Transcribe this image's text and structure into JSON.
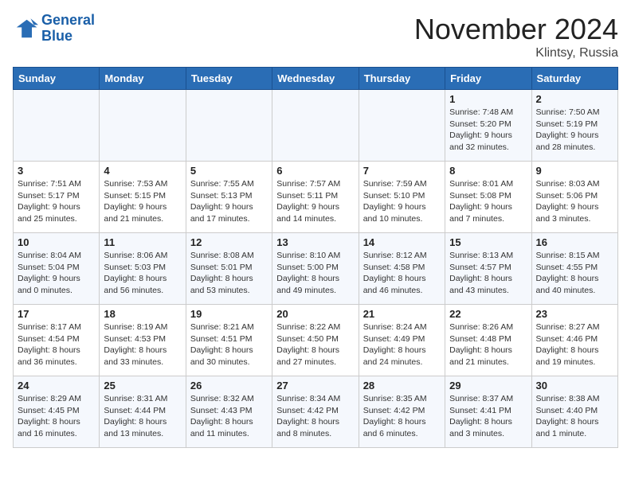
{
  "logo": {
    "line1": "General",
    "line2": "Blue"
  },
  "title": "November 2024",
  "location": "Klintsy, Russia",
  "days_of_week": [
    "Sunday",
    "Monday",
    "Tuesday",
    "Wednesday",
    "Thursday",
    "Friday",
    "Saturday"
  ],
  "weeks": [
    [
      {
        "day": "",
        "info": ""
      },
      {
        "day": "",
        "info": ""
      },
      {
        "day": "",
        "info": ""
      },
      {
        "day": "",
        "info": ""
      },
      {
        "day": "",
        "info": ""
      },
      {
        "day": "1",
        "info": "Sunrise: 7:48 AM\nSunset: 5:20 PM\nDaylight: 9 hours\nand 32 minutes."
      },
      {
        "day": "2",
        "info": "Sunrise: 7:50 AM\nSunset: 5:19 PM\nDaylight: 9 hours\nand 28 minutes."
      }
    ],
    [
      {
        "day": "3",
        "info": "Sunrise: 7:51 AM\nSunset: 5:17 PM\nDaylight: 9 hours\nand 25 minutes."
      },
      {
        "day": "4",
        "info": "Sunrise: 7:53 AM\nSunset: 5:15 PM\nDaylight: 9 hours\nand 21 minutes."
      },
      {
        "day": "5",
        "info": "Sunrise: 7:55 AM\nSunset: 5:13 PM\nDaylight: 9 hours\nand 17 minutes."
      },
      {
        "day": "6",
        "info": "Sunrise: 7:57 AM\nSunset: 5:11 PM\nDaylight: 9 hours\nand 14 minutes."
      },
      {
        "day": "7",
        "info": "Sunrise: 7:59 AM\nSunset: 5:10 PM\nDaylight: 9 hours\nand 10 minutes."
      },
      {
        "day": "8",
        "info": "Sunrise: 8:01 AM\nSunset: 5:08 PM\nDaylight: 9 hours\nand 7 minutes."
      },
      {
        "day": "9",
        "info": "Sunrise: 8:03 AM\nSunset: 5:06 PM\nDaylight: 9 hours\nand 3 minutes."
      }
    ],
    [
      {
        "day": "10",
        "info": "Sunrise: 8:04 AM\nSunset: 5:04 PM\nDaylight: 9 hours\nand 0 minutes."
      },
      {
        "day": "11",
        "info": "Sunrise: 8:06 AM\nSunset: 5:03 PM\nDaylight: 8 hours\nand 56 minutes."
      },
      {
        "day": "12",
        "info": "Sunrise: 8:08 AM\nSunset: 5:01 PM\nDaylight: 8 hours\nand 53 minutes."
      },
      {
        "day": "13",
        "info": "Sunrise: 8:10 AM\nSunset: 5:00 PM\nDaylight: 8 hours\nand 49 minutes."
      },
      {
        "day": "14",
        "info": "Sunrise: 8:12 AM\nSunset: 4:58 PM\nDaylight: 8 hours\nand 46 minutes."
      },
      {
        "day": "15",
        "info": "Sunrise: 8:13 AM\nSunset: 4:57 PM\nDaylight: 8 hours\nand 43 minutes."
      },
      {
        "day": "16",
        "info": "Sunrise: 8:15 AM\nSunset: 4:55 PM\nDaylight: 8 hours\nand 40 minutes."
      }
    ],
    [
      {
        "day": "17",
        "info": "Sunrise: 8:17 AM\nSunset: 4:54 PM\nDaylight: 8 hours\nand 36 minutes."
      },
      {
        "day": "18",
        "info": "Sunrise: 8:19 AM\nSunset: 4:53 PM\nDaylight: 8 hours\nand 33 minutes."
      },
      {
        "day": "19",
        "info": "Sunrise: 8:21 AM\nSunset: 4:51 PM\nDaylight: 8 hours\nand 30 minutes."
      },
      {
        "day": "20",
        "info": "Sunrise: 8:22 AM\nSunset: 4:50 PM\nDaylight: 8 hours\nand 27 minutes."
      },
      {
        "day": "21",
        "info": "Sunrise: 8:24 AM\nSunset: 4:49 PM\nDaylight: 8 hours\nand 24 minutes."
      },
      {
        "day": "22",
        "info": "Sunrise: 8:26 AM\nSunset: 4:48 PM\nDaylight: 8 hours\nand 21 minutes."
      },
      {
        "day": "23",
        "info": "Sunrise: 8:27 AM\nSunset: 4:46 PM\nDaylight: 8 hours\nand 19 minutes."
      }
    ],
    [
      {
        "day": "24",
        "info": "Sunrise: 8:29 AM\nSunset: 4:45 PM\nDaylight: 8 hours\nand 16 minutes."
      },
      {
        "day": "25",
        "info": "Sunrise: 8:31 AM\nSunset: 4:44 PM\nDaylight: 8 hours\nand 13 minutes."
      },
      {
        "day": "26",
        "info": "Sunrise: 8:32 AM\nSunset: 4:43 PM\nDaylight: 8 hours\nand 11 minutes."
      },
      {
        "day": "27",
        "info": "Sunrise: 8:34 AM\nSunset: 4:42 PM\nDaylight: 8 hours\nand 8 minutes."
      },
      {
        "day": "28",
        "info": "Sunrise: 8:35 AM\nSunset: 4:42 PM\nDaylight: 8 hours\nand 6 minutes."
      },
      {
        "day": "29",
        "info": "Sunrise: 8:37 AM\nSunset: 4:41 PM\nDaylight: 8 hours\nand 3 minutes."
      },
      {
        "day": "30",
        "info": "Sunrise: 8:38 AM\nSunset: 4:40 PM\nDaylight: 8 hours\nand 1 minute."
      }
    ]
  ]
}
